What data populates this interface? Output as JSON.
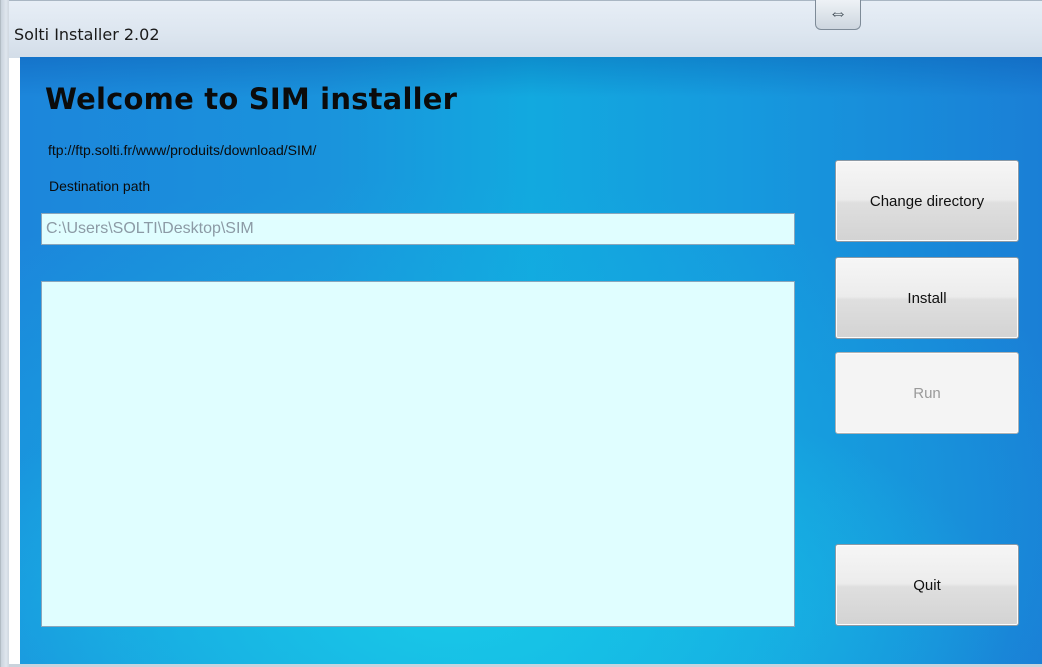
{
  "window": {
    "title": "Solti Installer 2.02",
    "resize_glyph": "⇔"
  },
  "main": {
    "heading": "Welcome to SIM installer",
    "ftp_url": "ftp://ftp.solti.fr/www/produits/download/SIM/",
    "destination_label": "Destination path",
    "destination_value": "C:\\Users\\SOLTI\\Desktop\\SIM",
    "log_text": ""
  },
  "buttons": {
    "change_directory": "Change directory",
    "install": "Install",
    "run": "Run",
    "quit": "Quit"
  },
  "colors": {
    "background_accent": "#12a9df",
    "input_background": "#e0feff",
    "disabled_text": "#9a9a9a"
  },
  "icons": {
    "resize": "resize-horizontal-icon"
  }
}
